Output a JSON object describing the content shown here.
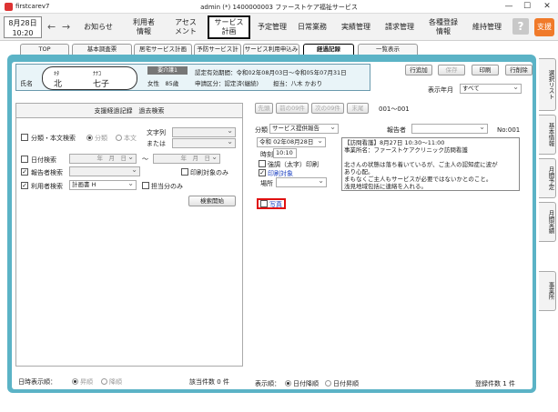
{
  "titlebar": {
    "app_name": "firstcarev7",
    "window_title": "admin (*) 1400000003 ファーストケア福祉サービス",
    "minimize": "—",
    "maximize": "☐",
    "close": "✕"
  },
  "date": {
    "date": "8月28日",
    "time": "10:20"
  },
  "menu": {
    "back": "←",
    "forward": "→",
    "items": [
      "お知らせ",
      "利用者\n情報",
      "アセス\nメント",
      "サービス\n計画",
      "予定管理",
      "日常業務",
      "実績管理",
      "請求管理",
      "各種登録\n情報",
      "維持管理"
    ],
    "help": "?",
    "support": "支援"
  },
  "subtabs": [
    "TOP",
    "基本調査票",
    "居宅サービス計画",
    "予防サービス計画",
    "サービス利用申込み",
    "経過記録",
    "一覧表示"
  ],
  "right_tabs": [
    "選択リスト",
    "基本情報",
    "月間予定",
    "月間実績",
    "事業所"
  ],
  "client": {
    "label": "氏名",
    "kana_last": "ｷﾀ",
    "kana_first": "ﾅﾅｺ",
    "last": "北",
    "first": "七子",
    "badge": "要介護1",
    "gender_age": "女性　85歳",
    "period": "認定有効期間：令和02年08月03日～令和05年07月31日",
    "status": "申請区分：認定済(継続)",
    "manager": "担当：八木 かおり"
  },
  "action_buttons": [
    "行追加",
    "保存",
    "印刷",
    "行削除"
  ],
  "year_month": {
    "label": "表示年月",
    "value": "すべて"
  },
  "search": {
    "title": "支援経過記録　過去検索",
    "category_label": "分類・本文検索",
    "opt_category": "分類",
    "opt_body": "本文",
    "text_label": "文字列",
    "or_label": "または",
    "date_label": "日付検索",
    "date_from": "年　月　日",
    "date_tilde": "～",
    "date_to": "年　月　日",
    "reporter_label": "報告者検索",
    "print_only": "印刷対象のみ",
    "user_label": "利用者検索",
    "user_value": "計画書 H",
    "charge_only": "担当分のみ",
    "search_button": "検索開始"
  },
  "list_nav": {
    "first": "先頭",
    "prev": "前の09件",
    "next": "次の09件",
    "last": "末尾",
    "counter": "001～001"
  },
  "record": {
    "category_label": "分類",
    "category_value": "サービス提供報告",
    "reporter_label": "報告者",
    "no_label": "No:001",
    "date_value": "令和 02年08月28日",
    "time_label": "時刻",
    "time_value": "10:10",
    "emphasis_print": "強調（太字）印刷",
    "print_target": "印刷対象",
    "place_label": "場所",
    "photo_label": "写真",
    "text": "【訪問看護】8月27日 10:30～11:00\n事業所名：ファーストケアクリニック訪問看護\n\n北さんの状態は落ち着いているが、ご主人の認知症に波が\nあり心配。\nまもなくご主人もサービスが必要ではないかとのこと。\n浅見地域包括に連絡を入れる。"
  },
  "footer": {
    "date_order_label": "日時表示順：",
    "asc": "昇順",
    "desc": "降順",
    "hit_count": "該当件数 0 件",
    "display_order_label": "表示順：",
    "date_desc": "日付降順",
    "date_asc": "日付昇順",
    "registered_count": "登録件数 1 件"
  }
}
